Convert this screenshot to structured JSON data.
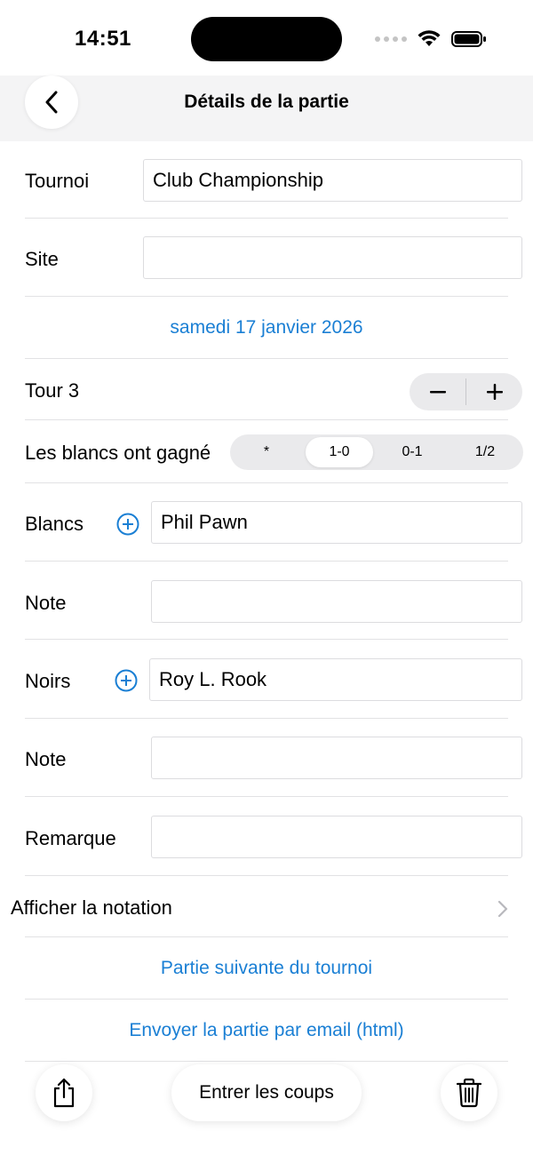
{
  "status_bar": {
    "time": "14:51"
  },
  "nav": {
    "title": "Détails de la partie"
  },
  "form": {
    "tournament_label": "Tournoi",
    "tournament_value": "Club Championship",
    "site_label": "Site",
    "site_value": "",
    "date": "samedi 17 janvier 2026",
    "round_label": "Tour 3",
    "result_label": "Les blancs ont gagné",
    "result_options": [
      "*",
      "1-0",
      "0-1",
      "1/2"
    ],
    "result_selected": "1-0",
    "white_label": "Blancs",
    "white_value": "Phil Pawn",
    "white_rating_label": "Note",
    "white_rating_value": "",
    "black_label": "Noirs",
    "black_value": "Roy L. Rook",
    "black_rating_label": "Note",
    "black_rating_value": "",
    "remark_label": "Remarque",
    "remark_value": ""
  },
  "actions": {
    "show_notation": "Afficher la notation",
    "next_game": "Partie suivante du tournoi",
    "email_game": "Envoyer la partie par email (html)"
  },
  "toolbar": {
    "enter_moves": "Entrer les coups"
  },
  "colors": {
    "accent": "#1a7fd4",
    "separator": "#e2e2e4",
    "nav_background": "#f4f4f5"
  },
  "icons": [
    "chevron-left-icon",
    "signal-dots-icon",
    "wifi-icon",
    "battery-icon",
    "minus-icon",
    "plus-icon",
    "plus-circle-icon",
    "chevron-right-icon",
    "share-icon",
    "trash-icon"
  ]
}
